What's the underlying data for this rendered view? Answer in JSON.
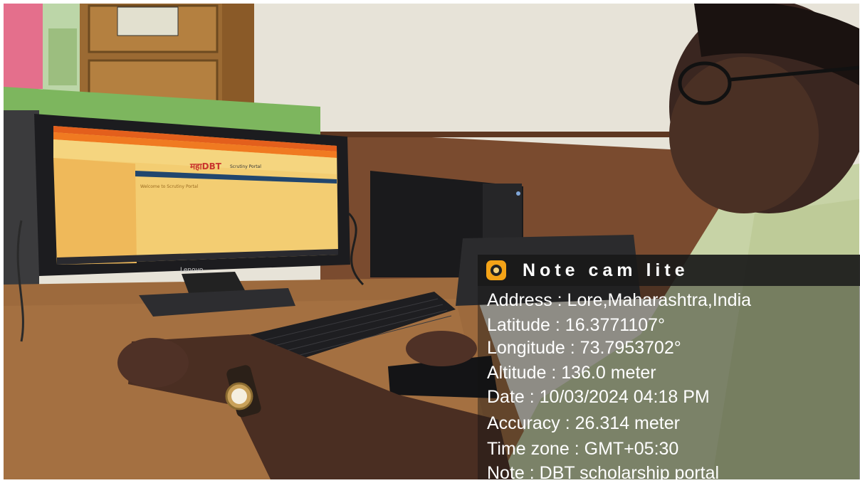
{
  "overlay": {
    "app_name": "Note cam lite",
    "address": "Address : Lore,Maharashtra,India",
    "latitude": "Latitude : 16.3771107°",
    "longitude": "Longitude : 73.7953702°",
    "altitude": "Altitude : 136.0 meter",
    "date": "Date : 10/03/2024 04:18 PM",
    "accuracy": "Accuracy : 26.314 meter",
    "timezone": "Time zone : GMT+05:30",
    "note": "Note : DBT scholarship portal"
  },
  "screen": {
    "portal_logo": "महाDBT",
    "portal_name": "Scrutiny Portal",
    "welcome": "Welcome to Scrutiny Portal",
    "monitor_brand": "Lenovo"
  },
  "colors": {
    "overlay_header": "#191919",
    "camera_icon": "#f4a317",
    "portal_orange": "#f07a21",
    "portal_body": "#f3cd72"
  },
  "icons": [
    "camera-icon"
  ]
}
